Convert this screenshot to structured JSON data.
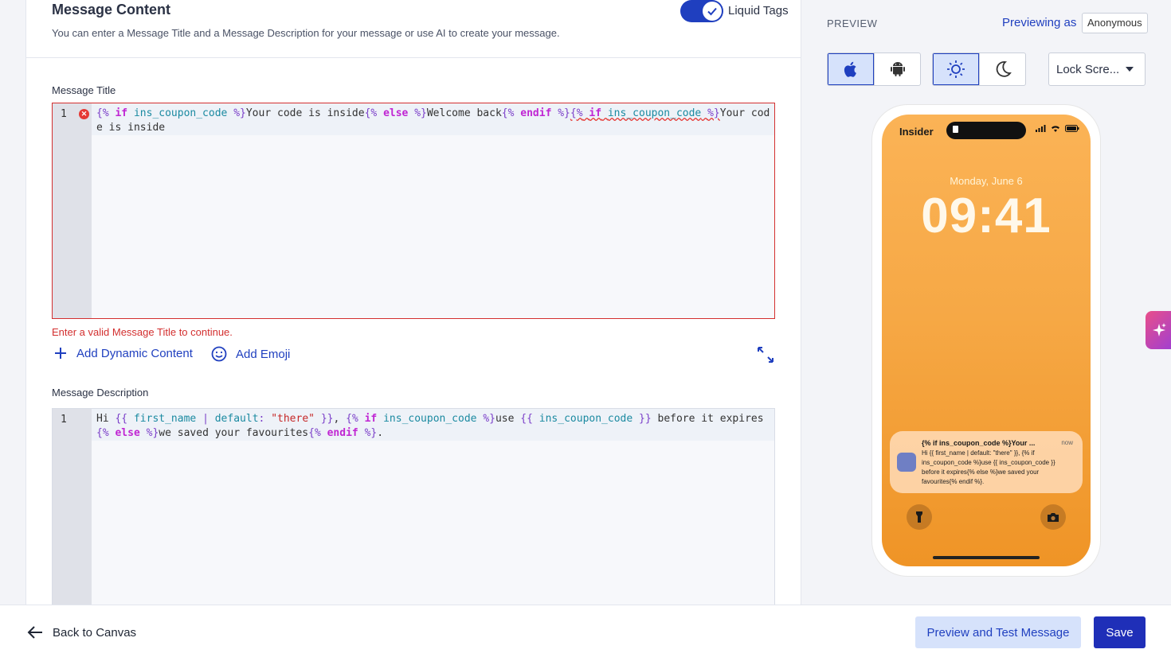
{
  "content": {
    "title": "Message Content",
    "subtitle": "You can enter a Message Title and a Message Description for your message or use AI to create your message.",
    "liquid_tags_label": "Liquid Tags",
    "liquid_tags_enabled": true
  },
  "message_title": {
    "label": "Message Title",
    "line_number": "1",
    "error_text": "Enter a valid Message Title to continue.",
    "code_tokens": [
      {
        "t": "{%",
        "c": "liq"
      },
      {
        "t": " "
      },
      {
        "t": "if",
        "c": "kw"
      },
      {
        "t": " "
      },
      {
        "t": "ins_coupon_code",
        "c": "var"
      },
      {
        "t": " "
      },
      {
        "t": "%}",
        "c": "liq"
      },
      {
        "t": "Your code is inside"
      },
      {
        "t": "{%",
        "c": "liq"
      },
      {
        "t": " "
      },
      {
        "t": "else",
        "c": "kw"
      },
      {
        "t": " "
      },
      {
        "t": "%}",
        "c": "liq"
      },
      {
        "t": "Welcome back"
      },
      {
        "t": "{%",
        "c": "liq"
      },
      {
        "t": " "
      },
      {
        "t": "endif",
        "c": "kw"
      },
      {
        "t": " "
      },
      {
        "t": "%}",
        "c": "liq"
      },
      {
        "t": "{%",
        "c": "liq squig"
      },
      {
        "t": " ",
        "c": "squig"
      },
      {
        "t": "if",
        "c": "kw squig"
      },
      {
        "t": " ",
        "c": "squig"
      },
      {
        "t": "ins_coupon_code",
        "c": "var squig"
      },
      {
        "t": " ",
        "c": "squig"
      },
      {
        "t": "%}",
        "c": "liq squig"
      },
      {
        "t": "Your code is inside"
      }
    ]
  },
  "actions": {
    "add_dynamic": "Add Dynamic Content",
    "add_emoji": "Add Emoji"
  },
  "message_description": {
    "label": "Message Description",
    "line_number": "1",
    "code_tokens": [
      {
        "t": "Hi "
      },
      {
        "t": "{{",
        "c": "liq"
      },
      {
        "t": " "
      },
      {
        "t": "first_name",
        "c": "var"
      },
      {
        "t": " "
      },
      {
        "t": "|",
        "c": "liq"
      },
      {
        "t": " "
      },
      {
        "t": "default",
        "c": "var"
      },
      {
        "t": ":",
        "c": "liq"
      },
      {
        "t": " "
      },
      {
        "t": "\"there\"",
        "c": "str"
      },
      {
        "t": " "
      },
      {
        "t": "}}",
        "c": "liq"
      },
      {
        "t": ", "
      },
      {
        "t": "{%",
        "c": "liq"
      },
      {
        "t": " "
      },
      {
        "t": "if",
        "c": "kw"
      },
      {
        "t": " "
      },
      {
        "t": "ins_coupon_code",
        "c": "var"
      },
      {
        "t": " "
      },
      {
        "t": "%}",
        "c": "liq"
      },
      {
        "t": "use "
      },
      {
        "t": "{{",
        "c": "liq"
      },
      {
        "t": " "
      },
      {
        "t": "ins_coupon_code",
        "c": "var"
      },
      {
        "t": " "
      },
      {
        "t": "}}",
        "c": "liq"
      },
      {
        "t": " before it expires"
      },
      {
        "t": "{%",
        "c": "liq"
      },
      {
        "t": " "
      },
      {
        "t": "else",
        "c": "kw"
      },
      {
        "t": " "
      },
      {
        "t": "%}",
        "c": "liq"
      },
      {
        "t": "we saved your favourites"
      },
      {
        "t": "{%",
        "c": "liq"
      },
      {
        "t": " "
      },
      {
        "t": "endif",
        "c": "kw"
      },
      {
        "t": " "
      },
      {
        "t": "%}",
        "c": "liq"
      },
      {
        "t": "."
      }
    ]
  },
  "preview": {
    "label": "PREVIEW",
    "previewing_as": "Previewing as",
    "audience": "Anonymous",
    "platform_selected": "ios",
    "theme_selected": "light",
    "view_dropdown": "Lock Scre...",
    "phone": {
      "carrier": "Insider",
      "date": "Monday, June 6",
      "time": "09:41",
      "notif_title": "{% if ins_coupon_code %}Your ...",
      "notif_time": "now",
      "notif_body": "Hi {{ first_name | default: \"there\" }}, {% if ins_coupon_code %}use {{ ins_coupon_code }} before it expires{% else %}we saved your favourites{% endif %}."
    }
  },
  "footer": {
    "back_label": "Back to Canvas",
    "preview_test_label": "Preview and Test Message",
    "save_label": "Save"
  },
  "colors": {
    "brand_blue": "#1f3fbf",
    "error_red": "#d32f2f",
    "phone_gradient_top": "#fbb356",
    "phone_gradient_bottom": "#ef9426"
  }
}
